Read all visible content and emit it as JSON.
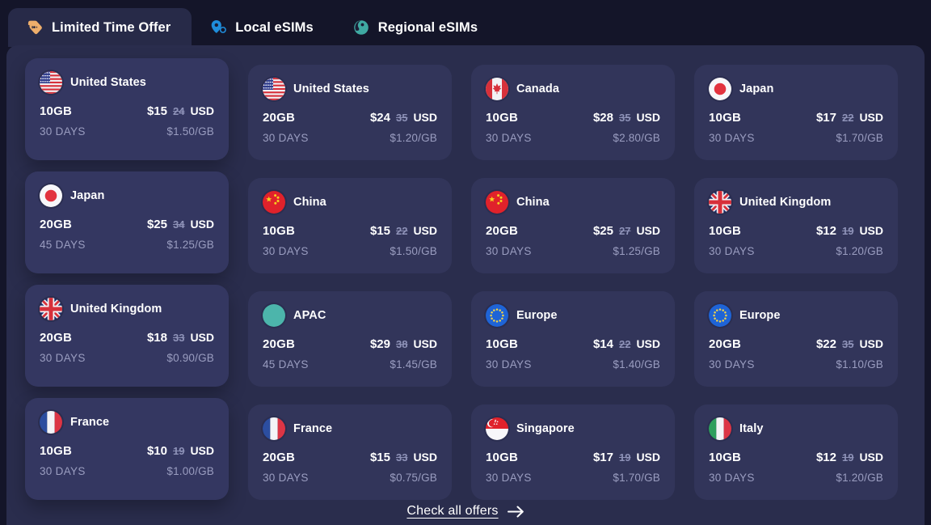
{
  "tabs": [
    {
      "label": "Limited Time Offer",
      "icon": "price-tag-icon",
      "active": true,
      "color": "#eeae6b"
    },
    {
      "label": "Local eSIMs",
      "icon": "location-pin-icon",
      "active": false,
      "color": "#1f8ddb"
    },
    {
      "label": "Regional eSIMs",
      "icon": "globe-icon",
      "active": false,
      "color": "#3fa9a2"
    }
  ],
  "colors": {
    "page_background": "#141529",
    "panel_background": "#2a2d4d",
    "card_background": "#32355a",
    "card_hover_background": "#343761",
    "text_primary": "#ffffff",
    "text_muted": "#9a9dc0",
    "strikethrough": "#8e92b8",
    "tab_active_background": "#272a48"
  },
  "offers": [
    {
      "country": "United States",
      "flag": "us",
      "data": "10GB",
      "price": "$15",
      "old_price": "24",
      "currency": "USD",
      "days": "30 DAYS",
      "per_gb": "$1.50/GB",
      "raised": true
    },
    {
      "country": "United States",
      "flag": "us",
      "data": "20GB",
      "price": "$24",
      "old_price": "35",
      "currency": "USD",
      "days": "30 DAYS",
      "per_gb": "$1.20/GB",
      "raised": false
    },
    {
      "country": "Canada",
      "flag": "ca",
      "data": "10GB",
      "price": "$28",
      "old_price": "35",
      "currency": "USD",
      "days": "30 DAYS",
      "per_gb": "$2.80/GB",
      "raised": false
    },
    {
      "country": "Japan",
      "flag": "jp",
      "data": "10GB",
      "price": "$17",
      "old_price": "22",
      "currency": "USD",
      "days": "30 DAYS",
      "per_gb": "$1.70/GB",
      "raised": false
    },
    {
      "country": "Japan",
      "flag": "jp",
      "data": "20GB",
      "price": "$25",
      "old_price": "34",
      "currency": "USD",
      "days": "45 DAYS",
      "per_gb": "$1.25/GB",
      "raised": true
    },
    {
      "country": "China",
      "flag": "cn",
      "data": "10GB",
      "price": "$15",
      "old_price": "22",
      "currency": "USD",
      "days": "30 DAYS",
      "per_gb": "$1.50/GB",
      "raised": false
    },
    {
      "country": "China",
      "flag": "cn",
      "data": "20GB",
      "price": "$25",
      "old_price": "27",
      "currency": "USD",
      "days": "30 DAYS",
      "per_gb": "$1.25/GB",
      "raised": false
    },
    {
      "country": "United Kingdom",
      "flag": "gb",
      "data": "10GB",
      "price": "$12",
      "old_price": "19",
      "currency": "USD",
      "days": "30 DAYS",
      "per_gb": "$1.20/GB",
      "raised": false
    },
    {
      "country": "United Kingdom",
      "flag": "gb",
      "data": "20GB",
      "price": "$18",
      "old_price": "33",
      "currency": "USD",
      "days": "30 DAYS",
      "per_gb": "$0.90/GB",
      "raised": true
    },
    {
      "country": "APAC",
      "flag": "apac",
      "data": "20GB",
      "price": "$29",
      "old_price": "38",
      "currency": "USD",
      "days": "45 DAYS",
      "per_gb": "$1.45/GB",
      "raised": false
    },
    {
      "country": "Europe",
      "flag": "eu",
      "data": "10GB",
      "price": "$14",
      "old_price": "22",
      "currency": "USD",
      "days": "30 DAYS",
      "per_gb": "$1.40/GB",
      "raised": false
    },
    {
      "country": "Europe",
      "flag": "eu",
      "data": "20GB",
      "price": "$22",
      "old_price": "35",
      "currency": "USD",
      "days": "30 DAYS",
      "per_gb": "$1.10/GB",
      "raised": false
    },
    {
      "country": "France",
      "flag": "fr",
      "data": "10GB",
      "price": "$10",
      "old_price": "19",
      "currency": "USD",
      "days": "30 DAYS",
      "per_gb": "$1.00/GB",
      "raised": true
    },
    {
      "country": "France",
      "flag": "fr",
      "data": "20GB",
      "price": "$15",
      "old_price": "33",
      "currency": "USD",
      "days": "30 DAYS",
      "per_gb": "$0.75/GB",
      "raised": false
    },
    {
      "country": "Singapore",
      "flag": "sg",
      "data": "10GB",
      "price": "$17",
      "old_price": "19",
      "currency": "USD",
      "days": "30 DAYS",
      "per_gb": "$1.70/GB",
      "raised": false
    },
    {
      "country": "Italy",
      "flag": "it",
      "data": "10GB",
      "price": "$12",
      "old_price": "19",
      "currency": "USD",
      "days": "30 DAYS",
      "per_gb": "$1.20/GB",
      "raised": false
    }
  ],
  "footer": {
    "link_label": "Check all offers",
    "arrow_icon": "arrow-right-icon"
  }
}
